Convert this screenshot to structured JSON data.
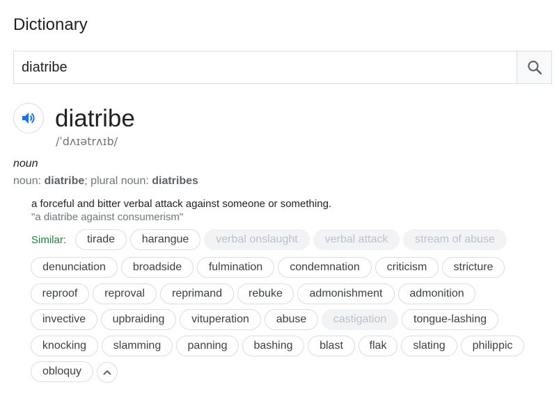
{
  "header": {
    "title": "Dictionary"
  },
  "search": {
    "query": "diatribe",
    "search_icon": "search-icon"
  },
  "entry": {
    "word": "diatribe",
    "phonetic": "/ˈdʌɪətrʌɪb/",
    "audio_icon": "speaker-icon",
    "part_of_speech": "noun",
    "forms": {
      "prefix": "noun: ",
      "word": "diatribe",
      "middle": "; plural noun: ",
      "plural": "diatribes"
    },
    "definition": "a forceful and bitter verbal attack against someone or something.",
    "example": "\"a diatribe against consumerism\"",
    "similar_label": "Similar:",
    "similar": [
      {
        "text": "tirade",
        "faded": false
      },
      {
        "text": "harangue",
        "faded": false
      },
      {
        "text": "verbal onslaught",
        "faded": true
      },
      {
        "text": "verbal attack",
        "faded": true
      },
      {
        "text": "stream of abuse",
        "faded": true
      },
      {
        "text": "denunciation",
        "faded": false
      },
      {
        "text": "broadside",
        "faded": false
      },
      {
        "text": "fulmination",
        "faded": false
      },
      {
        "text": "condemnation",
        "faded": false
      },
      {
        "text": "criticism",
        "faded": false
      },
      {
        "text": "stricture",
        "faded": false
      },
      {
        "text": "reproof",
        "faded": false
      },
      {
        "text": "reproval",
        "faded": false
      },
      {
        "text": "reprimand",
        "faded": false
      },
      {
        "text": "rebuke",
        "faded": false
      },
      {
        "text": "admonishment",
        "faded": false
      },
      {
        "text": "admonition",
        "faded": false
      },
      {
        "text": "invective",
        "faded": false
      },
      {
        "text": "upbraiding",
        "faded": false
      },
      {
        "text": "vituperation",
        "faded": false
      },
      {
        "text": "abuse",
        "faded": false
      },
      {
        "text": "castigation",
        "faded": true
      },
      {
        "text": "tongue-lashing",
        "faded": false
      },
      {
        "text": "knocking",
        "faded": false
      },
      {
        "text": "slamming",
        "faded": false
      },
      {
        "text": "panning",
        "faded": false
      },
      {
        "text": "bashing",
        "faded": false
      },
      {
        "text": "blast",
        "faded": false
      },
      {
        "text": "flak",
        "faded": false
      },
      {
        "text": "slating",
        "faded": false
      },
      {
        "text": "philippic",
        "faded": false
      },
      {
        "text": "obloquy",
        "faded": false
      }
    ],
    "collapse_icon": "chevron-up-icon"
  }
}
